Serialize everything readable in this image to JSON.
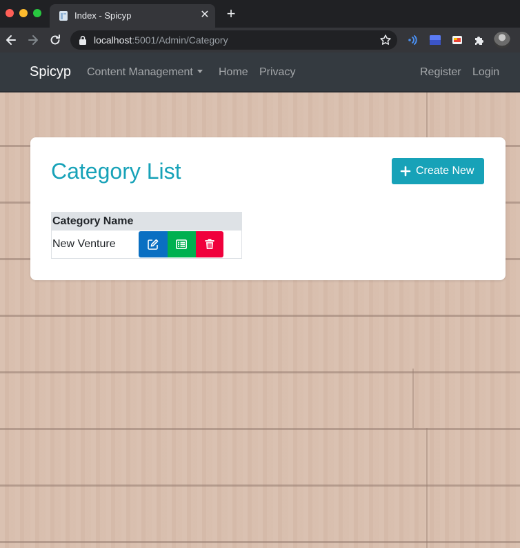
{
  "browser": {
    "tab_title": "Index - Spicyp",
    "close_tab_glyph": "✕",
    "new_tab_glyph": "+",
    "url_host": "localhost",
    "url_rest": ":5001/Admin/Category"
  },
  "navbar": {
    "brand": "Spicyp",
    "links": {
      "content_management": "Content Management",
      "home": "Home",
      "privacy": "Privacy",
      "register": "Register",
      "login": "Login"
    }
  },
  "card": {
    "title": "Category List",
    "create_button_label": "Create New"
  },
  "table": {
    "columns": [
      "Category Name"
    ],
    "rows": [
      {
        "name": "New Venture"
      }
    ]
  },
  "colors": {
    "accent": "#17a2b8",
    "navbar": "#343a40",
    "edit": "#0a6fc2",
    "details": "#00b050",
    "delete": "#f0003c"
  }
}
